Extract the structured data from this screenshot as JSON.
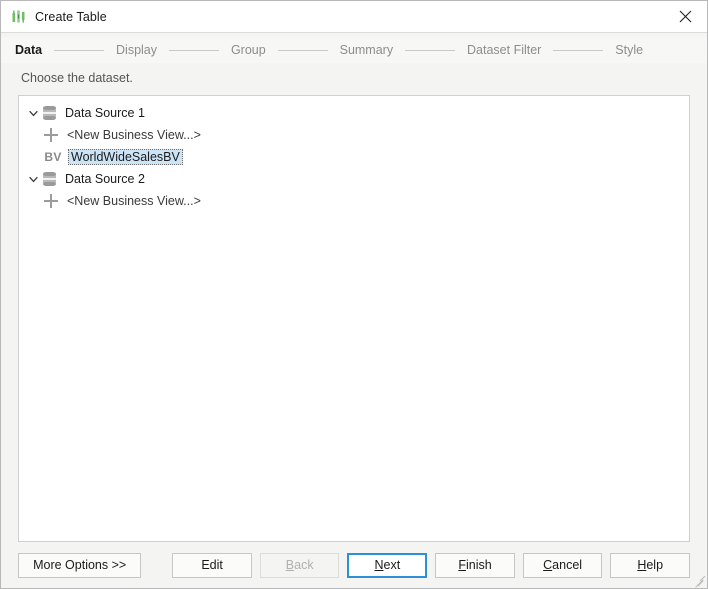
{
  "window": {
    "title": "Create Table",
    "icon": "bar-chart-icon",
    "close_label": "×",
    "accent": "#2d8fd5"
  },
  "steps": {
    "items": [
      {
        "label": "Data",
        "active": true
      },
      {
        "label": "Display",
        "active": false
      },
      {
        "label": "Group",
        "active": false
      },
      {
        "label": "Summary",
        "active": false
      },
      {
        "label": "Dataset Filter",
        "active": false
      },
      {
        "label": "Style",
        "active": false
      }
    ]
  },
  "instruction": "Choose the dataset.",
  "tree": {
    "nodes": [
      {
        "label": "Data Source 1",
        "icon": "database-icon",
        "expanded": true,
        "twisty": "⌄",
        "children": [
          {
            "label": "<New Business View...>",
            "icon": "plus-icon",
            "selected": false
          },
          {
            "label": "WorldWideSalesBV",
            "icon": "bv-icon",
            "icon_text": "BV",
            "selected": true
          }
        ]
      },
      {
        "label": "Data Source 2",
        "icon": "database-icon",
        "expanded": true,
        "twisty": "⌄",
        "children": [
          {
            "label": "<New Business View...>",
            "icon": "plus-icon",
            "selected": false
          }
        ]
      }
    ]
  },
  "footer": {
    "more_options": "More Options >>",
    "edit": "Edit",
    "back": "Back",
    "back_mnemonic": "B",
    "back_rest": "ack",
    "next_mnemonic": "N",
    "next_rest": "ext",
    "finish_mnemonic": "F",
    "finish_rest": "inish",
    "cancel_mnemonic": "C",
    "cancel_rest": "ancel",
    "help_mnemonic": "H",
    "help_rest": "elp"
  }
}
